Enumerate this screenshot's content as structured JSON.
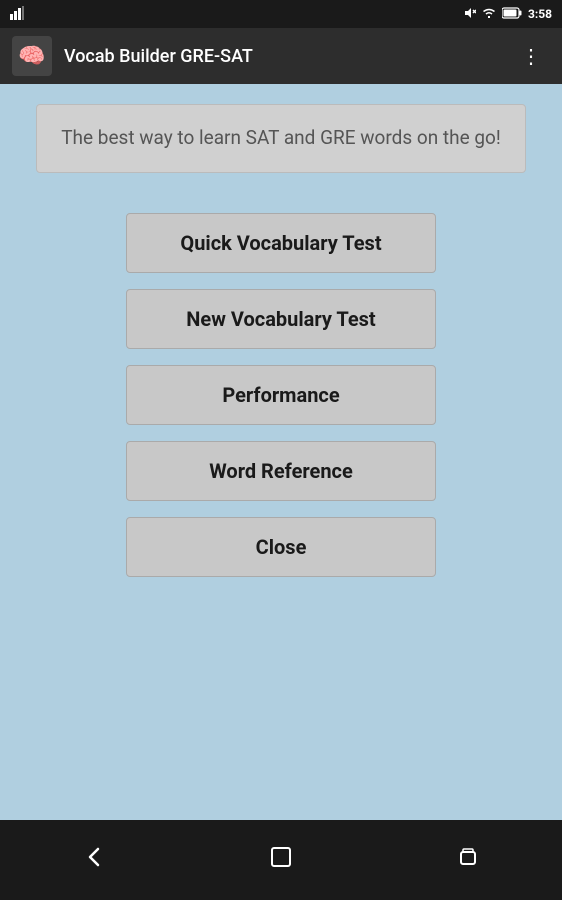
{
  "statusBar": {
    "time": "3:58",
    "icons": {
      "signal": "▲",
      "wifi": "wifi",
      "battery": "battery"
    }
  },
  "toolbar": {
    "appName": "Vocab Builder GRE-SAT",
    "menuIcon": "⋮"
  },
  "banner": {
    "text": "The best way to learn SAT and GRE words on the go!"
  },
  "buttons": [
    {
      "id": "quick-vocab-test",
      "label": "Quick Vocabulary Test"
    },
    {
      "id": "new-vocab-test",
      "label": "New Vocabulary Test"
    },
    {
      "id": "performance",
      "label": "Performance"
    },
    {
      "id": "word-reference",
      "label": "Word Reference"
    },
    {
      "id": "close",
      "label": "Close"
    }
  ],
  "navBar": {
    "back": "◁",
    "home": "⬜",
    "recent": "▣"
  },
  "colors": {
    "background": "#b0cfe0",
    "toolbar": "#2d2d2d",
    "statusBar": "#1a1a1a",
    "button": "#c8c8c8",
    "banner": "#d0d0d0",
    "navBar": "#1a1a1a"
  }
}
